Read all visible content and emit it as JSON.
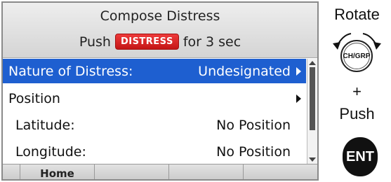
{
  "screen": {
    "title": "Compose Distress",
    "instruction_prefix": "Push",
    "instruction_badge": "DISTRESS",
    "instruction_suffix": "for 3 sec",
    "items": [
      {
        "label": "Nature of Distress:",
        "value": "Undesignated",
        "selected": true,
        "has_arrow": true
      },
      {
        "label": "Position",
        "value": "",
        "selected": false,
        "has_arrow": true
      },
      {
        "label": "Latitude:",
        "value": "No Position",
        "selected": false,
        "has_arrow": false
      },
      {
        "label": "Longitude:",
        "value": "No Position",
        "selected": false,
        "has_arrow": false
      }
    ],
    "softkeys": [
      "",
      "Home",
      "",
      "",
      ""
    ]
  },
  "panel": {
    "rotate_label": "Rotate",
    "knob_label": "CH/GRP",
    "plus": "+",
    "push_label": "Push",
    "ent_label": "ENT"
  },
  "colors": {
    "selection": "#1e5fd0",
    "distress_badge": "#d42020"
  }
}
